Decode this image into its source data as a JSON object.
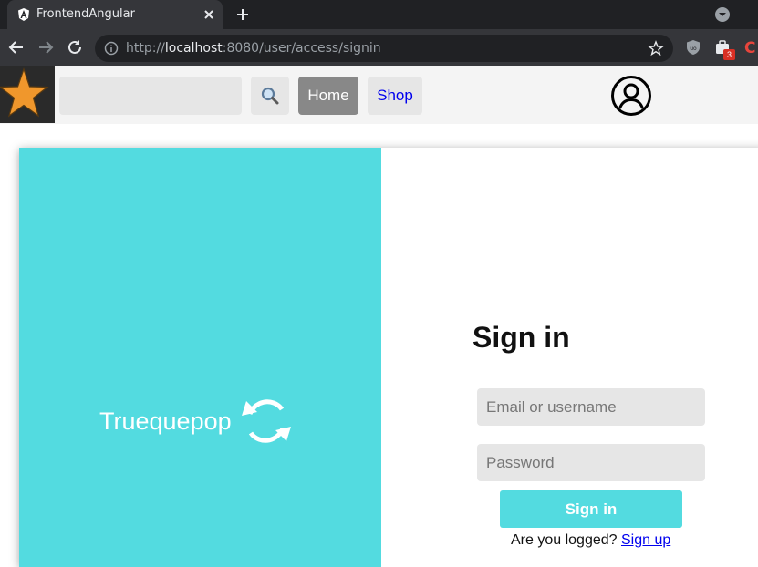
{
  "browser": {
    "tab_title": "FrontendAngular",
    "url_scheme": "http://",
    "url_host": "localhost",
    "url_path": ":8080/user/access/signin",
    "extension_badge": "3"
  },
  "header": {
    "search_placeholder": "",
    "search_icon": "magnifier-icon",
    "nav_home": "Home",
    "nav_shop": "Shop",
    "user_icon": "user-circle-icon"
  },
  "brand": {
    "name": "Truequepop",
    "icon": "sync-icon"
  },
  "signin": {
    "title": "Sign in",
    "email_placeholder": "Email or username",
    "password_placeholder": "Password",
    "button_label": "Sign in",
    "prompt": "Are you logged?",
    "signup_link": "Sign up"
  },
  "colors": {
    "accent": "#53dbe0",
    "home_button": "#888888",
    "chrome_dark": "#202124"
  }
}
